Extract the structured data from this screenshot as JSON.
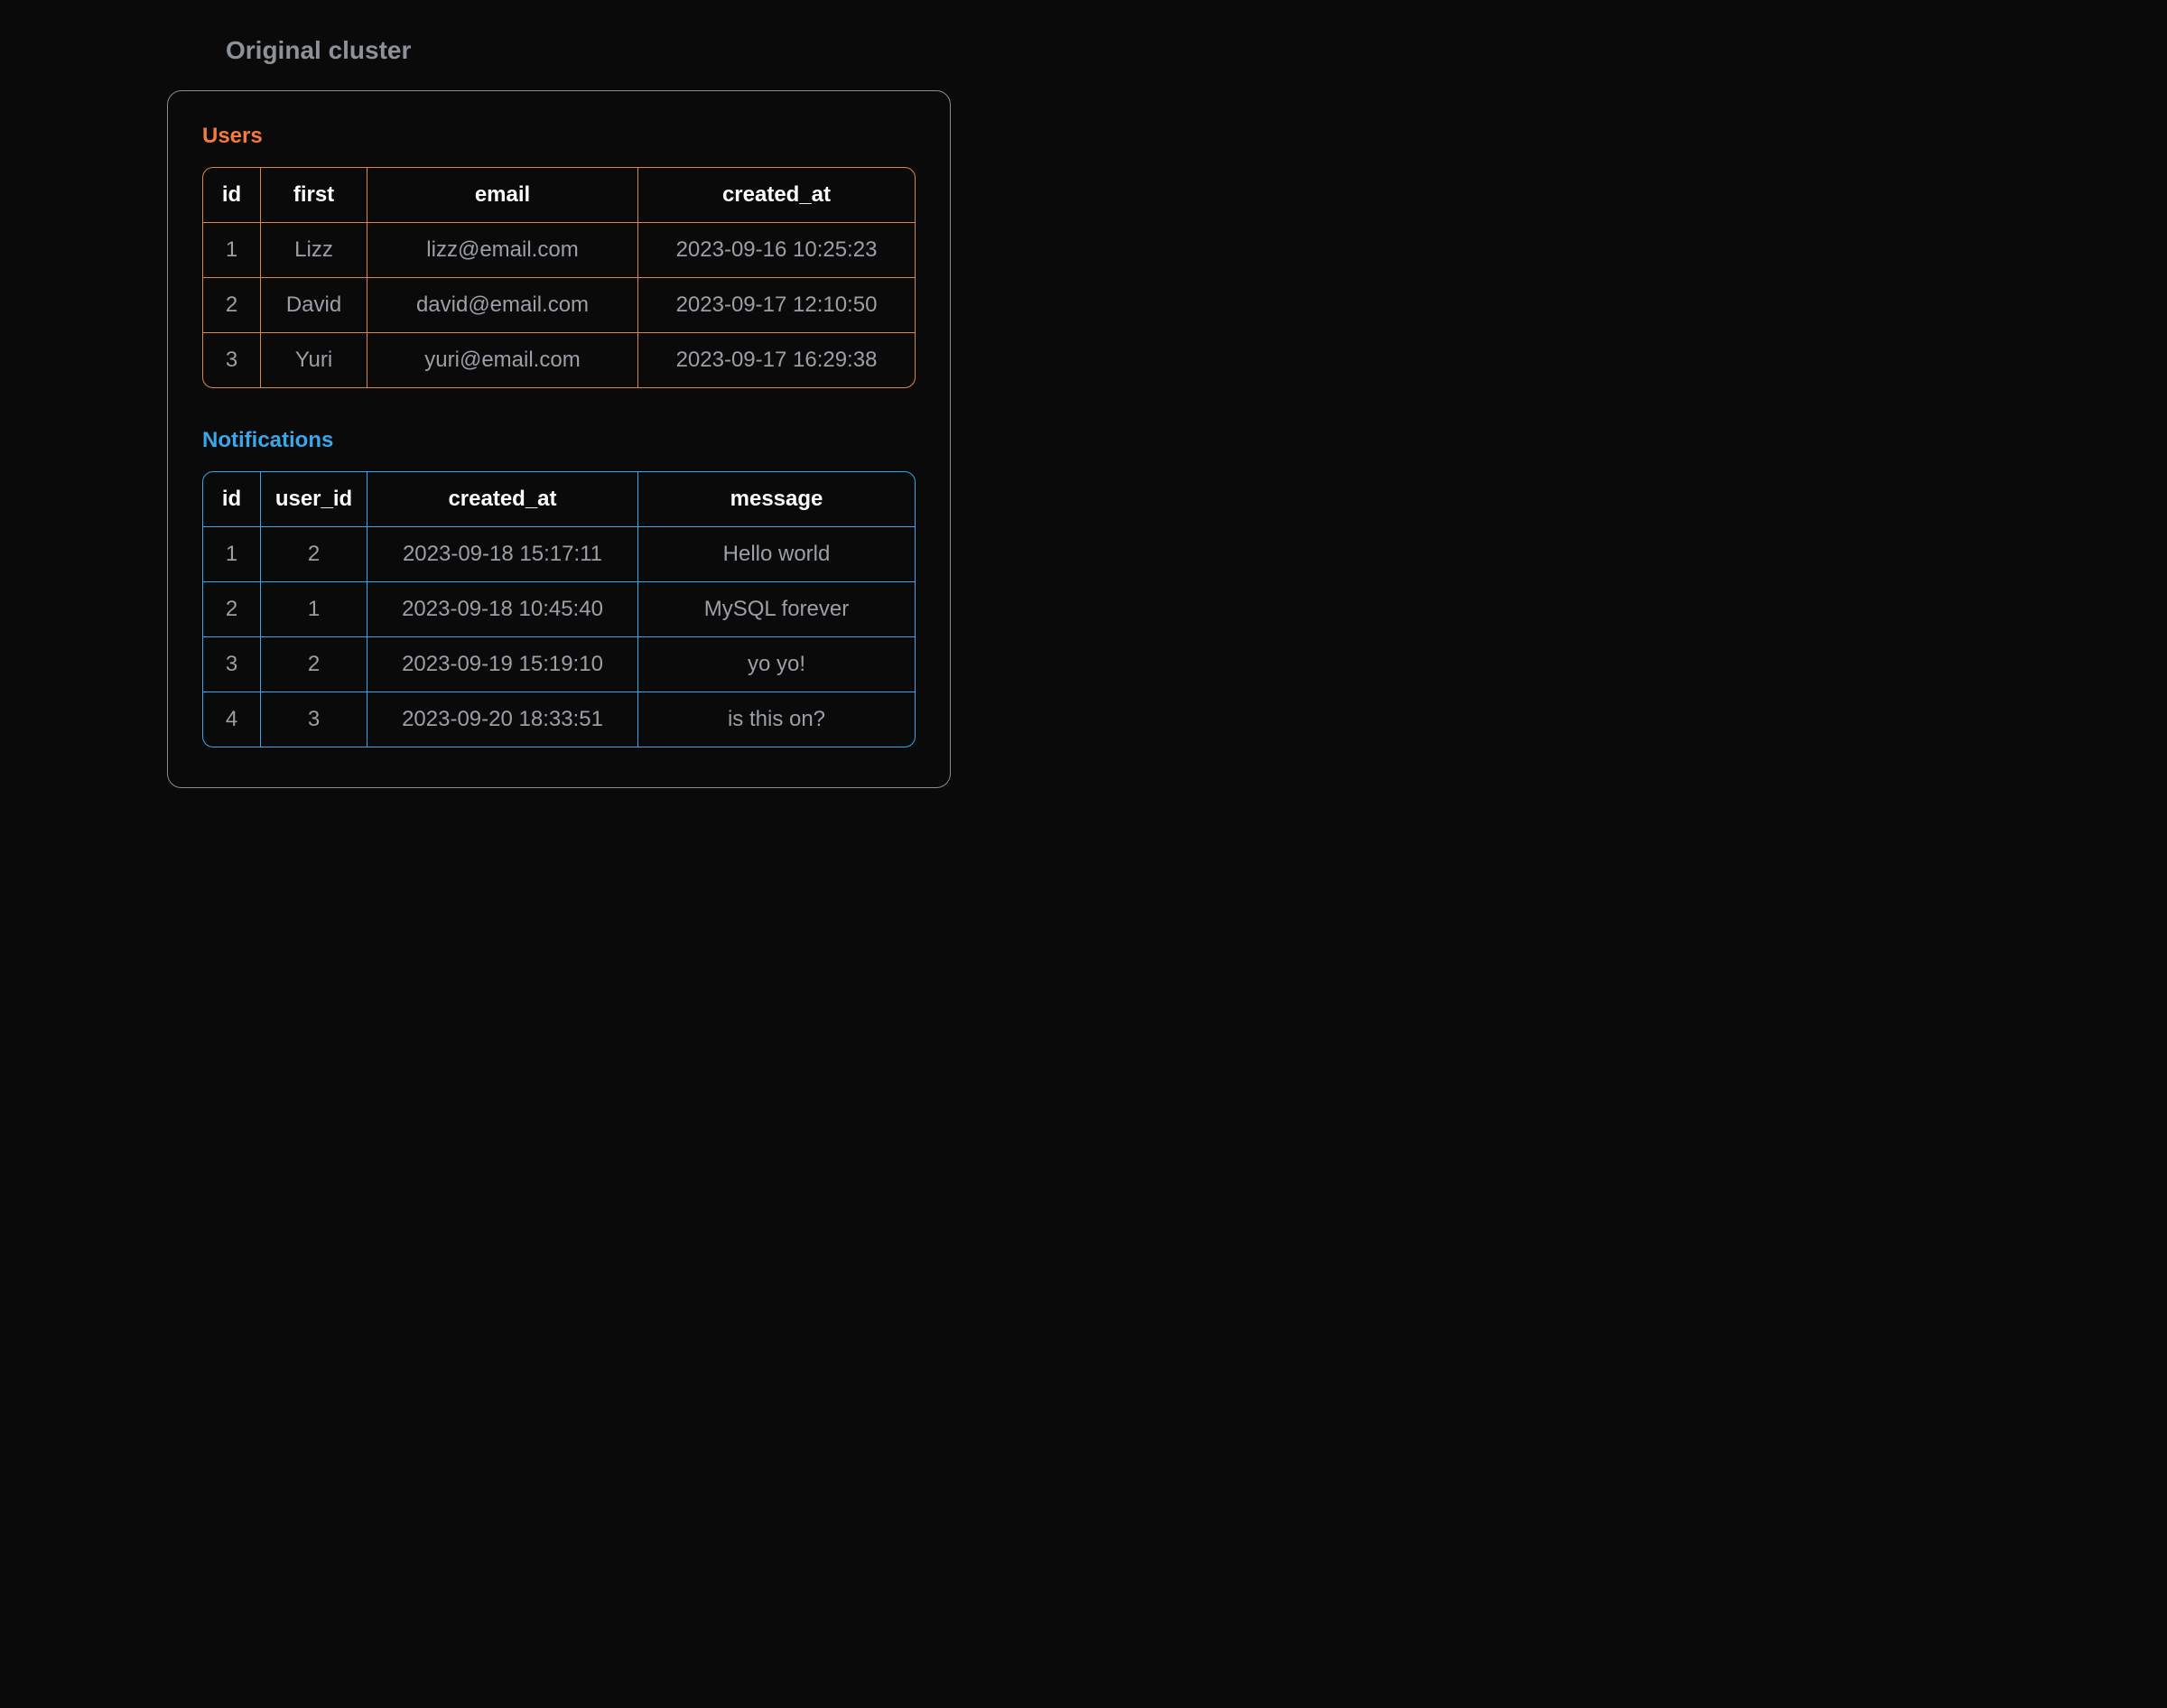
{
  "title": "Original cluster",
  "users": {
    "label": "Users",
    "headers": [
      "id",
      "first",
      "email",
      "created_at"
    ],
    "rows": [
      [
        "1",
        "Lizz",
        "lizz@email.com",
        "2023-09-16 10:25:23"
      ],
      [
        "2",
        "David",
        "david@email.com",
        "2023-09-17 12:10:50"
      ],
      [
        "3",
        "Yuri",
        "yuri@email.com",
        "2023-09-17 16:29:38"
      ]
    ]
  },
  "notifications": {
    "label": "Notifications",
    "headers": [
      "id",
      "user_id",
      "created_at",
      "message"
    ],
    "rows": [
      [
        "1",
        "2",
        "2023-09-18 15:17:11",
        "Hello world"
      ],
      [
        "2",
        "1",
        "2023-09-18 10:45:40",
        "MySQL forever"
      ],
      [
        "3",
        "2",
        "2023-09-19 15:19:10",
        "yo yo!"
      ],
      [
        "4",
        "3",
        "2023-09-20 18:33:51",
        "is this on?"
      ]
    ]
  },
  "colors": {
    "users_border": "#d9884d",
    "users_title": "#f47a3e",
    "notifications_border": "#3ba6e9",
    "notifications_title": "#3ba6e9"
  }
}
